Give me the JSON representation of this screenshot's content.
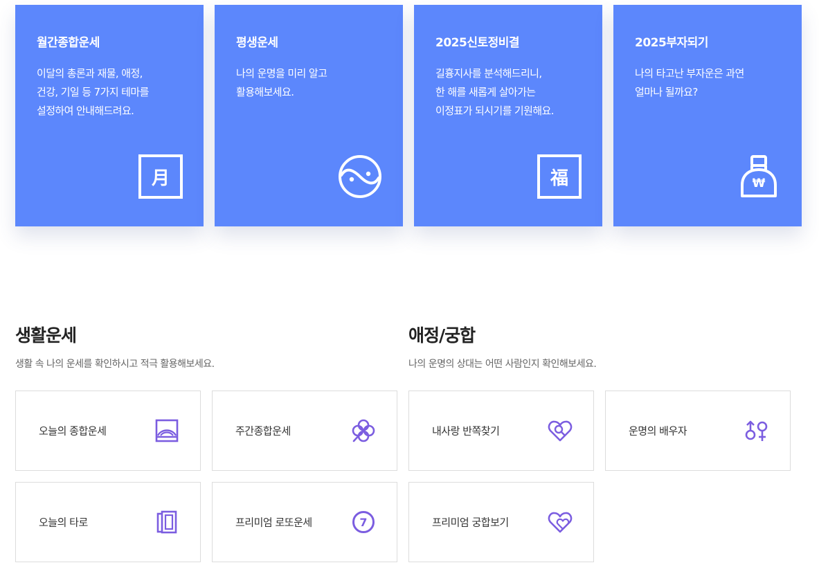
{
  "top_cards": [
    {
      "title": "월간종합운세",
      "desc": "이달의 총론과 재물, 애정,\n건강, 기일 등 7가지 테마를\n설정하여 안내해드려요.",
      "icon": "calendar-month-icon",
      "glyph": "月"
    },
    {
      "title": "평생운세",
      "desc": "나의 운명을 미리 알고\n활용해보세요.",
      "icon": "yin-yang-icon"
    },
    {
      "title": "2025신토정비결",
      "desc": "길흉지사를 분석해드리니,\n한 해를 새롭게 살아가는\n이정표가 되시기를 기원해요.",
      "icon": "fortune-bok-icon",
      "glyph": "福"
    },
    {
      "title": "2025부자되기",
      "desc": "나의 타고난 부자운은 과연\n얼마나 될까요?",
      "icon": "money-bag-icon",
      "glyph": "₩"
    }
  ],
  "sections": {
    "life": {
      "title": "생활운세",
      "subtitle": "생활 속 나의 운세를 확인하시고 적극 활용해보세요.",
      "items": [
        {
          "label": "오늘의 종합운세",
          "icon": "sunrise-frame-icon"
        },
        {
          "label": "주간종합운세",
          "icon": "clover-icon"
        },
        {
          "label": "오늘의 타로",
          "icon": "tarot-cards-icon"
        },
        {
          "label": "프리미엄 로또운세",
          "icon": "lotto-seven-icon",
          "glyph": "7"
        }
      ]
    },
    "love": {
      "title": "애정/궁합",
      "subtitle": "나의 운명의 상대는 어떤 사람인지 확인해보세요.",
      "items": [
        {
          "label": "내사랑 반쪽찾기",
          "icon": "heart-search-icon"
        },
        {
          "label": "운명의 배우자",
          "icon": "gender-couple-icon"
        },
        {
          "label": "프리미엄 궁합보기",
          "icon": "double-heart-icon"
        }
      ]
    }
  },
  "colors": {
    "card_blue": "#5c87fc",
    "icon_purple": "#7b5de0",
    "border_gray": "#dcdcdc"
  }
}
